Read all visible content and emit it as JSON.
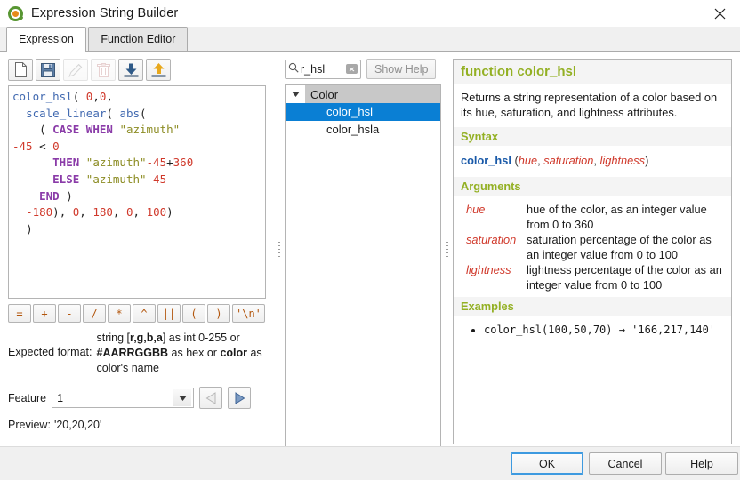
{
  "window": {
    "title": "Expression String Builder",
    "logo_icon": "qgis-logo-icon",
    "close_icon": "close-icon"
  },
  "tabs": [
    {
      "label": "Expression",
      "active": true
    },
    {
      "label": "Function Editor",
      "active": false
    }
  ],
  "toolbar": [
    {
      "name": "new-expression-button",
      "icon": "new-file-icon",
      "enabled": true
    },
    {
      "name": "save-expression-button",
      "icon": "save-floppy-icon",
      "enabled": true
    },
    {
      "name": "edit-expression-button",
      "icon": "pencil-edit-icon",
      "enabled": false
    },
    {
      "name": "delete-expression-button",
      "icon": "trash-delete-icon",
      "enabled": false
    },
    {
      "name": "import-expressions-button",
      "icon": "import-down-arrow-icon",
      "enabled": true
    },
    {
      "name": "export-expressions-button",
      "icon": "export-up-arrow-icon",
      "enabled": true
    }
  ],
  "expression": {
    "lines": [
      [
        {
          "t": "color_hsl",
          "c": "fn"
        },
        {
          "t": "( ",
          "c": "pl"
        },
        {
          "t": "0",
          "c": "num"
        },
        {
          "t": ",",
          "c": "pl"
        },
        {
          "t": "0",
          "c": "num"
        },
        {
          "t": ",",
          "c": "pl"
        }
      ],
      [
        {
          "t": "  ",
          "c": "pl"
        },
        {
          "t": "scale_linear",
          "c": "fn"
        },
        {
          "t": "( ",
          "c": "pl"
        },
        {
          "t": "abs",
          "c": "fn"
        },
        {
          "t": "(",
          "c": "pl"
        }
      ],
      [
        {
          "t": "    ( ",
          "c": "pl"
        },
        {
          "t": "CASE WHEN",
          "c": "kw"
        },
        {
          "t": " ",
          "c": "pl"
        },
        {
          "t": "\"azimuth\"",
          "c": "str"
        }
      ],
      [
        {
          "t": "-45",
          "c": "num"
        },
        {
          "t": " < ",
          "c": "pl"
        },
        {
          "t": "0",
          "c": "num"
        }
      ],
      [
        {
          "t": "      ",
          "c": "pl"
        },
        {
          "t": "THEN",
          "c": "kw"
        },
        {
          "t": " ",
          "c": "pl"
        },
        {
          "t": "\"azimuth\"",
          "c": "str"
        },
        {
          "t": "-45",
          "c": "num"
        },
        {
          "t": "+",
          "c": "pl"
        },
        {
          "t": "360",
          "c": "num"
        }
      ],
      [
        {
          "t": "      ",
          "c": "pl"
        },
        {
          "t": "ELSE",
          "c": "kw"
        },
        {
          "t": " ",
          "c": "pl"
        },
        {
          "t": "\"azimuth\"",
          "c": "str"
        },
        {
          "t": "-45",
          "c": "num"
        }
      ],
      [
        {
          "t": "    ",
          "c": "pl"
        },
        {
          "t": "END",
          "c": "kw"
        },
        {
          "t": " )",
          "c": "pl"
        }
      ],
      [
        {
          "t": "  ",
          "c": "pl"
        },
        {
          "t": "-180",
          "c": "num"
        },
        {
          "t": "), ",
          "c": "pl"
        },
        {
          "t": "0",
          "c": "num"
        },
        {
          "t": ", ",
          "c": "pl"
        },
        {
          "t": "180",
          "c": "num"
        },
        {
          "t": ", ",
          "c": "pl"
        },
        {
          "t": "0",
          "c": "num"
        },
        {
          "t": ", ",
          "c": "pl"
        },
        {
          "t": "100",
          "c": "num"
        },
        {
          "t": ")",
          "c": "pl"
        }
      ],
      [
        {
          "t": "  )",
          "c": "pl"
        }
      ]
    ],
    "plain_text": "color_hsl( 0,0,\n  scale_linear( abs(\n    ( CASE WHEN \"azimuth\"-45 < 0\n      THEN \"azimuth\"-45+360\n      ELSE \"azimuth\"-45\n    END )\n  -180), 0, 180, 0, 100)\n  )"
  },
  "operators": [
    {
      "label": "=",
      "name": "operator-equals-button"
    },
    {
      "label": "+",
      "name": "operator-plus-button"
    },
    {
      "label": "-",
      "name": "operator-minus-button"
    },
    {
      "label": "/",
      "name": "operator-divide-button"
    },
    {
      "label": "*",
      "name": "operator-multiply-button"
    },
    {
      "label": "^",
      "name": "operator-power-button"
    },
    {
      "label": "||",
      "name": "operator-concat-button"
    },
    {
      "label": "(",
      "name": "operator-open-paren-button"
    },
    {
      "label": ")",
      "name": "operator-close-paren-button"
    },
    {
      "label": "'\\n'",
      "name": "operator-newline-button"
    }
  ],
  "expected_format": {
    "label": "Expected format:",
    "parts": [
      {
        "t": "string [",
        "b": false
      },
      {
        "t": "r,g,b,a",
        "b": true
      },
      {
        "t": "] as int 0-255 or ",
        "b": false
      },
      {
        "t": "#AARRGGBB",
        "b": true
      },
      {
        "t": " as hex or ",
        "b": false
      },
      {
        "t": "color",
        "b": true
      },
      {
        "t": " as color's name",
        "b": false
      }
    ]
  },
  "feature": {
    "label": "Feature",
    "value": "1",
    "dropdown_icon": "chevron-down-icon",
    "prev_icon": "triangle-left-icon",
    "next_icon": "triangle-right-icon",
    "prev_enabled": false,
    "next_enabled": true
  },
  "preview": {
    "label": "Preview:",
    "value": "'20,20,20'"
  },
  "search": {
    "value": "r_hsl",
    "placeholder": "Search",
    "icon": "search-magnifier-icon",
    "clear_icon": "clear-x-icon"
  },
  "show_help_button": {
    "label": "Show Help",
    "enabled": false
  },
  "function_tree": {
    "groups": [
      {
        "label": "Color",
        "expanded": true,
        "twisty_icon": "triangle-down-icon",
        "items": [
          {
            "label": "color_hsl",
            "selected": true
          },
          {
            "label": "color_hsla",
            "selected": false
          }
        ]
      }
    ]
  },
  "help": {
    "title": "function color_hsl",
    "description": "Returns a string representation of a color based on its hue, saturation, and lightness attributes.",
    "syntax_heading": "Syntax",
    "syntax": {
      "name": "color_hsl",
      "open": " (",
      "args": [
        "hue",
        "saturation",
        "lightness"
      ],
      "separator": ", ",
      "close": ")"
    },
    "arguments_heading": "Arguments",
    "arguments": [
      {
        "name": "hue",
        "description": "hue of the color, as an integer value from 0 to 360"
      },
      {
        "name": "saturation",
        "description": "saturation percentage of the color as an integer value from 0 to 100"
      },
      {
        "name": "lightness",
        "description": "lightness percentage of the color as an integer value from 0 to 100"
      }
    ],
    "examples_heading": "Examples",
    "examples": [
      "color_hsl(100,50,70) → '166,217,140'"
    ]
  },
  "footer": {
    "ok_label": "OK",
    "cancel_label": "Cancel",
    "help_label": "Help"
  },
  "colors": {
    "accent_blue": "#0a7fd4",
    "heading_green": "#93b023",
    "arg_red": "#d0392b",
    "syntax_blue": "#1959a8",
    "keyword_purple": "#8a3ba8",
    "string_olive": "#8c8c23",
    "operator_orange": "#b2560d"
  }
}
